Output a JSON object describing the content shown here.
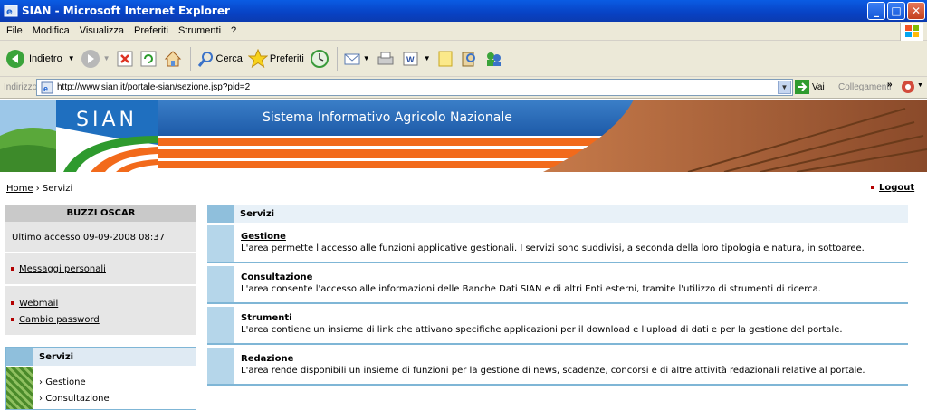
{
  "window": {
    "title": "SIAN - Microsoft Internet Explorer"
  },
  "menu": [
    "File",
    "Modifica",
    "Visualizza",
    "Preferiti",
    "Strumenti",
    "?"
  ],
  "toolbar": {
    "back": "Indietro",
    "search": "Cerca",
    "favorites": "Preferiti"
  },
  "address": {
    "label": "Indirizzo",
    "url": "http://www.sian.it/portale-sian/sezione.jsp?pid=2",
    "go": "Vai",
    "links": "Collegamenti"
  },
  "banner": {
    "logo": "SIAN",
    "title": "Sistema Informativo Agricolo Nazionale"
  },
  "breadcrumb": {
    "home": "Home",
    "current": "Servizi"
  },
  "logout": "Logout",
  "user": {
    "name": "BUZZI OSCAR",
    "last_access": "Ultimo accesso 09-09-2008 08:37",
    "messages": "Messaggi personali",
    "webmail": "Webmail",
    "change_password": "Cambio password"
  },
  "side_services": {
    "title": "Servizi",
    "items": [
      "Gestione",
      "Consultazione"
    ]
  },
  "main": {
    "title": "Servizi",
    "rows": [
      {
        "title": "Gestione",
        "desc": "L'area permette l'accesso alle funzioni applicative gestionali. I servizi sono suddivisi, a seconda della loro tipologia e natura, in sottoaree."
      },
      {
        "title": "Consultazione",
        "desc": "L'area consente l'accesso alle informazioni delle Banche Dati SIAN e di altri Enti esterni, tramite l'utilizzo di strumenti di ricerca."
      },
      {
        "title": "Strumenti",
        "desc": "L'area contiene un insieme di link che attivano specifiche applicazioni per il download e l'upload di dati e per la gestione del portale."
      },
      {
        "title": "Redazione",
        "desc": "L'area rende disponibili un insieme di funzioni per la gestione di news, scadenze, concorsi e di altre attività redazionali relative al portale."
      }
    ]
  }
}
